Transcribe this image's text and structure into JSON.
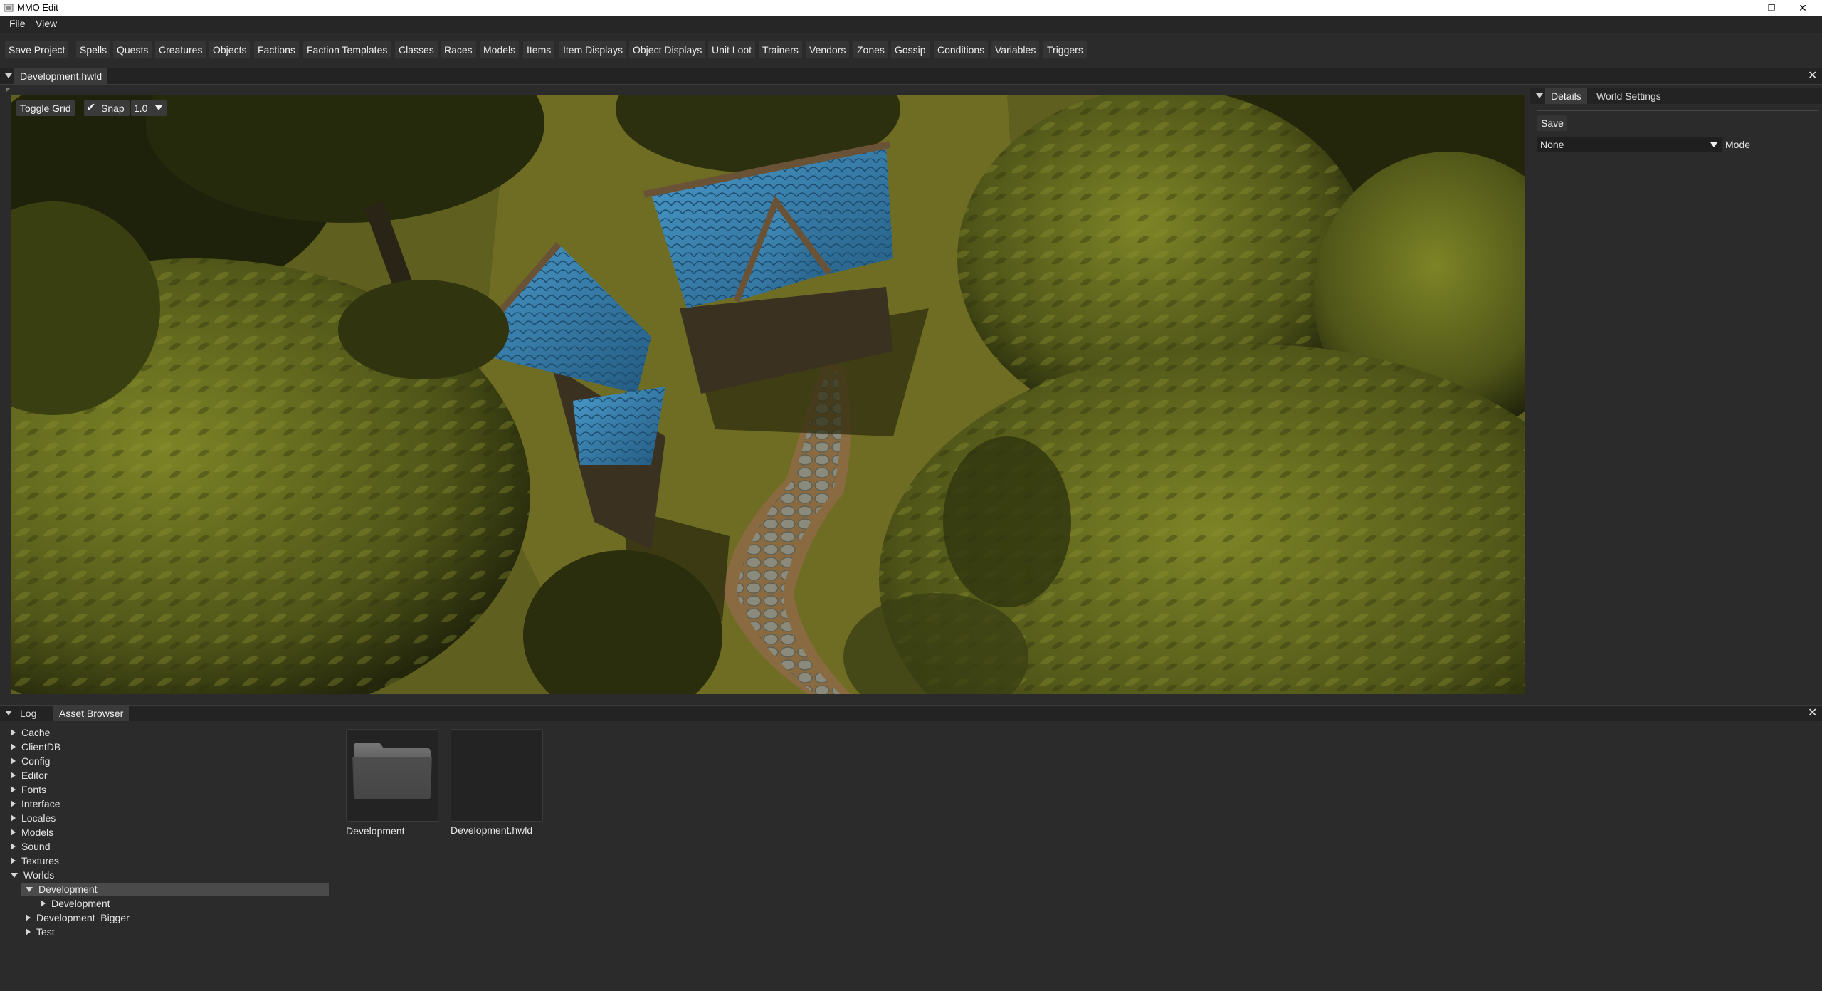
{
  "window": {
    "title": "MMO Edit",
    "minimize": "–",
    "restore": "❐",
    "close": "✕"
  },
  "menu": [
    "File",
    "View"
  ],
  "toolbar": [
    "Save Project",
    "Spells",
    "Quests",
    "Creatures",
    "Objects",
    "Factions",
    "Faction Templates",
    "Classes",
    "Races",
    "Models",
    "Items",
    "Item Displays",
    "Object Displays",
    "Unit Loot",
    "Trainers",
    "Vendors",
    "Zones",
    "Gossip",
    "Conditions",
    "Variables",
    "Triggers"
  ],
  "document_tab": "Development.hwld",
  "viewport": {
    "toggle_grid": "Toggle Grid",
    "snap_label": "Snap",
    "snap_checked": true,
    "snap_value": "1.0",
    "scene_colors": {
      "grass": "#6b6a22",
      "path": "#7c7c70",
      "roof": "#3f86b8",
      "foliage": "#6f7420",
      "shadow": "#22240c"
    }
  },
  "details": {
    "tabs": [
      "Details",
      "World Settings"
    ],
    "save": "Save",
    "mode_value": "None",
    "mode_label": "Mode"
  },
  "bottom_tabs": [
    "Log",
    "Asset Browser"
  ],
  "tree": [
    {
      "label": "Cache",
      "expanded": false
    },
    {
      "label": "ClientDB",
      "expanded": false
    },
    {
      "label": "Config",
      "expanded": false
    },
    {
      "label": "Editor",
      "expanded": false
    },
    {
      "label": "Fonts",
      "expanded": false
    },
    {
      "label": "Interface",
      "expanded": false
    },
    {
      "label": "Locales",
      "expanded": false
    },
    {
      "label": "Models",
      "expanded": false
    },
    {
      "label": "Sound",
      "expanded": false
    },
    {
      "label": "Textures",
      "expanded": false
    },
    {
      "label": "Worlds",
      "expanded": true
    },
    {
      "label": "Development",
      "expanded": true,
      "selected": true
    },
    {
      "label": "Development",
      "expanded": false
    },
    {
      "label": "Development_Bigger",
      "expanded": false
    },
    {
      "label": "Test",
      "expanded": false
    }
  ],
  "assets": [
    {
      "label": "Development",
      "icon": "folder-icon"
    },
    {
      "label": "Development.hwld",
      "icon": "file-icon"
    }
  ]
}
